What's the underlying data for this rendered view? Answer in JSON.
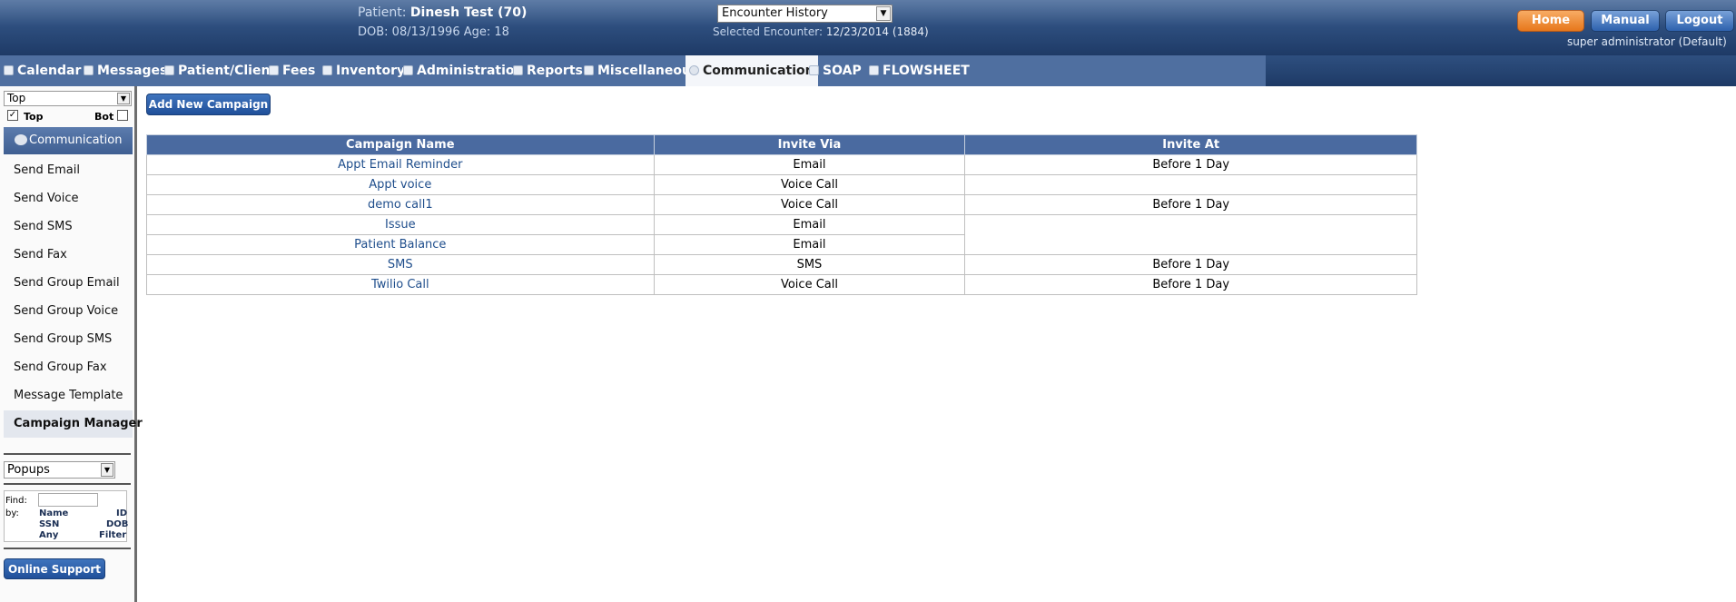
{
  "header": {
    "patient_prefix": "Patient: ",
    "patient_name": "Dinesh Test (70)",
    "dob_line": "DOB: 08/13/1996 Age: 18",
    "encounter_select": "Encounter History",
    "selected_encounter_prefix": "Selected Encounter: ",
    "selected_encounter_value": "12/23/2014 (1884)",
    "home_label": "Home",
    "manual_label": "Manual",
    "logout_label": "Logout",
    "user_label": "super administrator (Default)"
  },
  "nav": {
    "tabs": [
      {
        "label": "Calendar",
        "icon": "calendar-icon"
      },
      {
        "label": "Messages",
        "icon": "messages-icon"
      },
      {
        "label": "Patient/Client",
        "icon": "patient-icon"
      },
      {
        "label": "Fees",
        "icon": "fees-icon"
      },
      {
        "label": "Inventory",
        "icon": "inventory-icon"
      },
      {
        "label": "Administration",
        "icon": "administration-icon"
      },
      {
        "label": "Reports",
        "icon": "reports-icon"
      },
      {
        "label": "Miscellaneous",
        "icon": "miscellaneous-icon"
      },
      {
        "label": "Communication",
        "icon": "communication-icon",
        "active": true
      },
      {
        "label": "SOAP",
        "icon": "soap-icon"
      },
      {
        "label": "FLOWSHEET",
        "icon": "flowsheet-icon"
      }
    ]
  },
  "sidebar": {
    "frame_select": "Top",
    "top_label": "Top",
    "bot_label": "Bot",
    "top_checked": true,
    "bot_checked": false,
    "section_title": "Communication",
    "items": [
      {
        "label": "Send Email"
      },
      {
        "label": "Send Voice"
      },
      {
        "label": "Send SMS"
      },
      {
        "label": "Send Fax"
      },
      {
        "label": "Send Group Email"
      },
      {
        "label": "Send Group Voice"
      },
      {
        "label": "Send Group SMS"
      },
      {
        "label": "Send Group Fax"
      },
      {
        "label": "Message Template"
      },
      {
        "label": "Campaign Manager",
        "active": true
      }
    ],
    "popups_select": "Popups",
    "find": {
      "find_label": "Find:",
      "by_label": "by:",
      "name": "Name",
      "id": "ID",
      "ssn": "SSN",
      "dob": "DOB",
      "any": "Any",
      "filter": "Filter"
    },
    "support_label": "Online Support"
  },
  "main": {
    "add_button": "Add New Campaign",
    "table": {
      "headers": [
        "Campaign Name",
        "Invite Via",
        "Invite At"
      ],
      "rows": [
        {
          "name": "Appt Email Reminder",
          "via": "Email",
          "at": "Before 1 Day"
        },
        {
          "name": "Appt voice",
          "via": "Voice Call",
          "at": ""
        },
        {
          "name": "demo call1",
          "via": "Voice Call",
          "at": "Before 1 Day"
        },
        {
          "name": "Issue",
          "via": "Email",
          "at": ""
        },
        {
          "name": "Patient Balance",
          "via": "Email",
          "at": ""
        },
        {
          "name": "SMS",
          "via": "SMS",
          "at": "Before 1 Day"
        },
        {
          "name": "Twilio Call",
          "via": "Voice Call",
          "at": "Before 1 Day"
        }
      ]
    }
  },
  "colors": {
    "header_dark": "#1e3a66",
    "nav_blue": "#4f6fa0",
    "table_header": "#4a6aa0",
    "link_blue": "#1f4e8c",
    "home_orange": "#e7781d"
  }
}
